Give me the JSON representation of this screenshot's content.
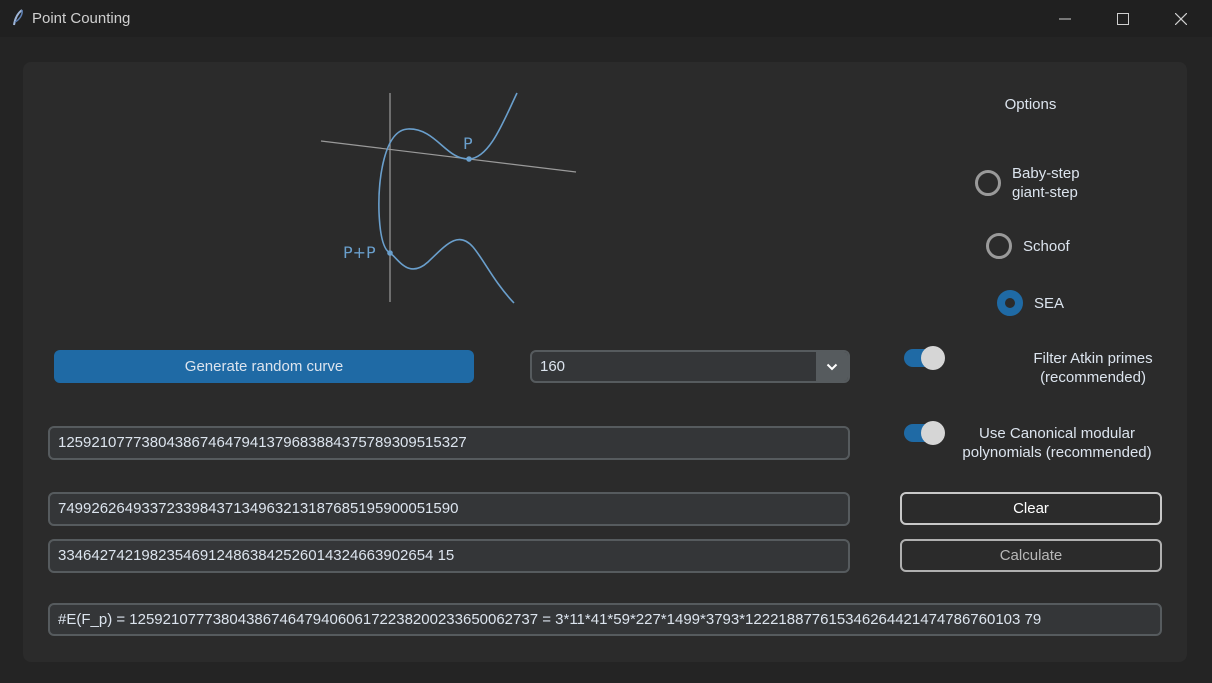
{
  "window": {
    "title": "Point Counting"
  },
  "illustration": {
    "label_p": "P",
    "label_pp": "P+P"
  },
  "options": {
    "title": "Options",
    "radios": [
      {
        "line1": "Baby-step",
        "line2": "giant-step",
        "checked": false
      },
      {
        "line1": "Schoof",
        "checked": false
      },
      {
        "line1": "SEA",
        "checked": true
      }
    ],
    "atkin": {
      "line1": "Filter Atkin primes",
      "line2": "(recommended)",
      "on": true
    },
    "canonical": {
      "line1": "Use Canonical modular",
      "line2": "polynomials (recommended)",
      "on": true
    }
  },
  "controls": {
    "generate_label": "Generate random curve",
    "bits_value": "160",
    "clear_label": "Clear",
    "calculate_label": "Calculate"
  },
  "fields": {
    "p": "1259210777380438674647941379683884375789309515327",
    "a": "749926264933723398437134963213187685195900051590",
    "b": "334642742198235469124863842526014324663902654 15"
  },
  "result": "#E(F_p) = 1259210777380438674647940606172238200233650062737 = 3*11*41*59*227*1499*3793*122218877615346264421474786760103 79",
  "colors": {
    "accent": "#1f6aa5",
    "curve": "#6a9fcc"
  }
}
